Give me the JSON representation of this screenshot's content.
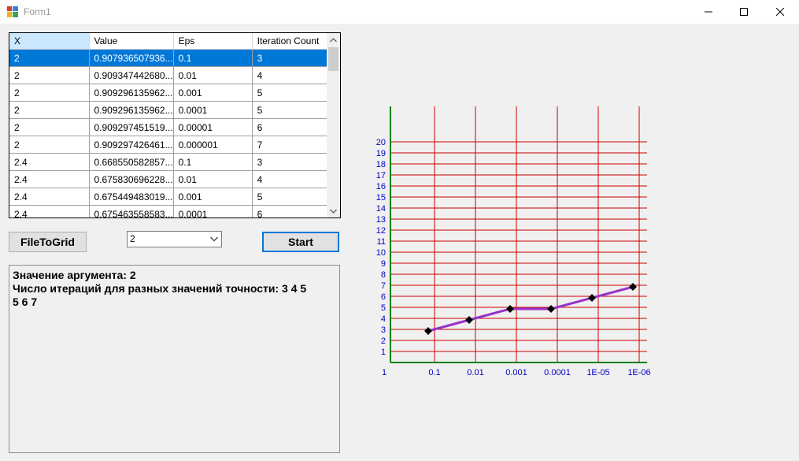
{
  "window": {
    "title": "Form1"
  },
  "grid": {
    "columns": [
      "X",
      "Value",
      "Eps",
      "Iteration Count"
    ],
    "rows": [
      [
        "2",
        "0.907936507936...",
        "0.1",
        "3"
      ],
      [
        "2",
        "0.909347442680...",
        "0.01",
        "4"
      ],
      [
        "2",
        "0.909296135962...",
        "0.001",
        "5"
      ],
      [
        "2",
        "0.909296135962...",
        "0.0001",
        "5"
      ],
      [
        "2",
        "0.909297451519...",
        "0.00001",
        "6"
      ],
      [
        "2",
        "0.909297426461...",
        "0.000001",
        "7"
      ],
      [
        "2.4",
        "0.668550582857...",
        "0.1",
        "3"
      ],
      [
        "2.4",
        "0.675830696228...",
        "0.01",
        "4"
      ],
      [
        "2.4",
        "0.675449483019...",
        "0.001",
        "5"
      ],
      [
        "2.4",
        "0.675463558583...",
        "0.0001",
        "6"
      ]
    ],
    "selected_row": 0
  },
  "buttons": {
    "file_to_grid": "FileToGrid",
    "start": "Start"
  },
  "combo": {
    "value": "2"
  },
  "output": {
    "line1": "Значение аргумента: 2",
    "line2": "Число итераций для разных значений точности: 3 4 5",
    "line3": "5 6 7"
  },
  "colors": {
    "grid_lines": "#cc0000",
    "axis": "#008000",
    "labels": "#0000c0",
    "series": "#9932cc",
    "markers": "#000000",
    "selection": "#0078d7"
  },
  "chart_data": {
    "type": "line",
    "categories": [
      "1",
      "0.1",
      "0.01",
      "0.001",
      "0.0001",
      "1E-05",
      "1E-06"
    ],
    "series": [
      {
        "values": [
          null,
          3,
          4,
          5,
          5,
          6,
          7
        ]
      }
    ],
    "y_ticks": [
      1,
      2,
      3,
      4,
      5,
      6,
      7,
      8,
      9,
      10,
      11,
      12,
      13,
      14,
      15,
      16,
      17,
      18,
      19,
      20
    ],
    "ylim": [
      0,
      20
    ],
    "grid": true
  }
}
